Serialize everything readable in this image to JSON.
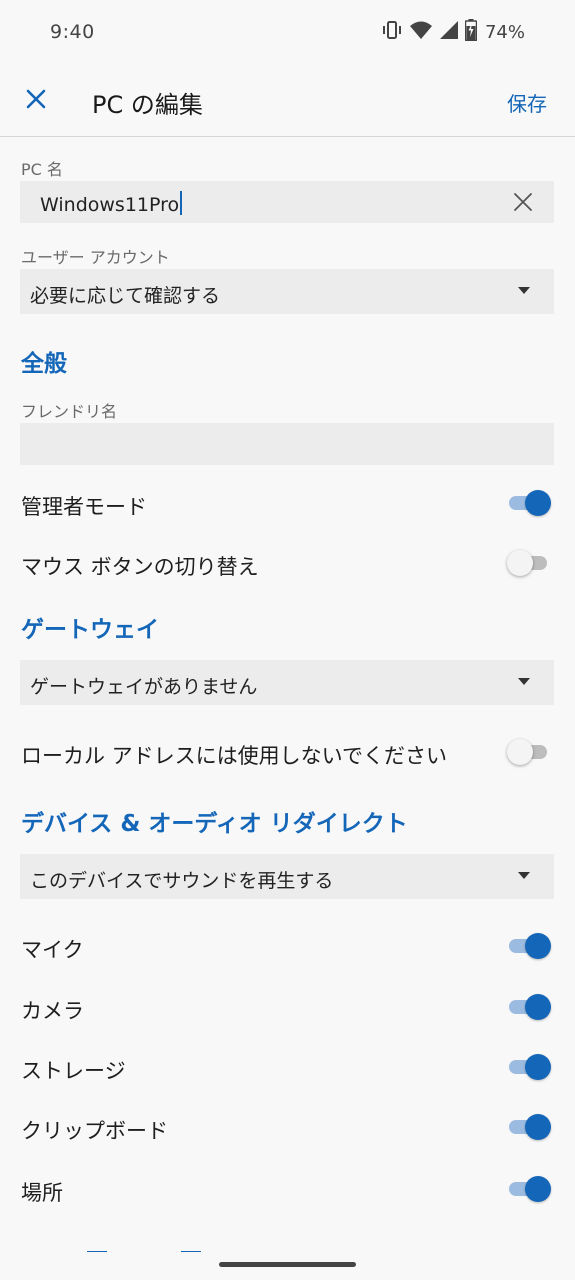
{
  "status_bar": {
    "time": "9:40",
    "battery": "74%",
    "icons": [
      "vibrate-icon",
      "wifi-icon",
      "signal-icon",
      "battery-charging-icon"
    ]
  },
  "app_bar": {
    "close_icon": "close-icon",
    "title": "PC の編集",
    "save_label": "保存"
  },
  "pc_name": {
    "label": "PC 名",
    "value": "Windows11Pro",
    "clear_icon": "clear-icon"
  },
  "user_account": {
    "label": "ユーザー アカウント",
    "selected": "必要に応じて確認する"
  },
  "general": {
    "header": "全般",
    "friendly_name_label": "フレンドリ名",
    "friendly_name_value": "",
    "admin_mode": {
      "label": "管理者モード",
      "on": true
    },
    "swap_mouse": {
      "label": "マウス ボタンの切り替え",
      "on": false
    }
  },
  "gateway": {
    "header": "ゲートウェイ",
    "selected": "ゲートウェイがありません",
    "bypass_local": {
      "label": "ローカル アドレスには使用しないでください",
      "on": false
    }
  },
  "redirect": {
    "header": "デバイス & オーディオ リダイレクト",
    "sound_selected": "このデバイスでサウンドを再生する",
    "mic": {
      "label": "マイク",
      "on": true
    },
    "camera": {
      "label": "カメラ",
      "on": true
    },
    "storage": {
      "label": "ストレージ",
      "on": true
    },
    "clipboard": {
      "label": "クリップボード",
      "on": true
    },
    "location": {
      "label": "場所",
      "on": true
    }
  },
  "colors": {
    "accent": "#1466b8",
    "background": "#f8f8f8",
    "field_background": "#ececec"
  }
}
